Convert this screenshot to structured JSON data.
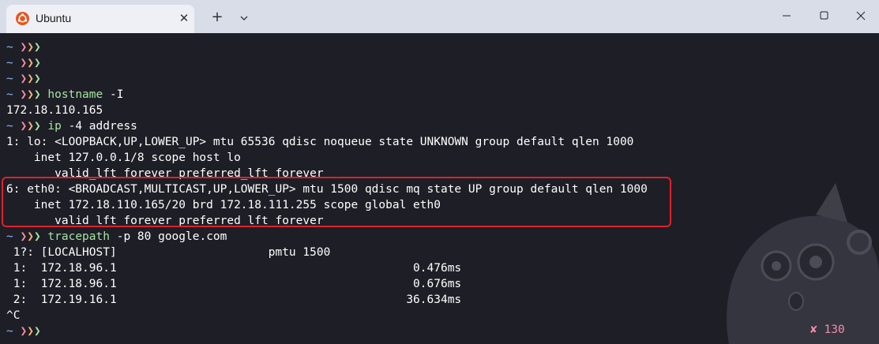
{
  "window": {
    "tab_title": "Ubuntu",
    "tab_close_glyph": "✕",
    "new_tab_glyph": "+",
    "icons": {
      "app": "ubuntu-logo-icon",
      "dropdown": "chevron-down-icon",
      "minimize": "minimize-icon",
      "maximize": "maximize-icon",
      "close": "close-icon"
    },
    "colors": {
      "titlebar": "#d9dde8",
      "tab": "#eef0f5",
      "terminal_bg": "#1e1e26",
      "highlight_border": "#e0202a"
    }
  },
  "prompt": {
    "tilde": "~",
    "arrow": "❯",
    "colors": {
      "tilde": "#89b4fa",
      "arrow1": "#f38ba8",
      "arrow2": "#f9b27a",
      "arrow3": "#a6e3a1",
      "command": "#a6e3a1"
    }
  },
  "terminal": {
    "lines": [
      {
        "type": "prompt",
        "cmd": "",
        "args": ""
      },
      {
        "type": "prompt",
        "cmd": "",
        "args": ""
      },
      {
        "type": "prompt",
        "cmd": "",
        "args": ""
      },
      {
        "type": "prompt",
        "cmd": "hostname",
        "args": " -I"
      },
      {
        "type": "output",
        "text": "172.18.110.165"
      },
      {
        "type": "prompt",
        "cmd": "ip",
        "args": " -4 address"
      },
      {
        "type": "output",
        "text": "1: lo: <LOOPBACK,UP,LOWER_UP> mtu 65536 qdisc noqueue state UNKNOWN group default qlen 1000"
      },
      {
        "type": "output",
        "text": "    inet 127.0.0.1/8 scope host lo"
      },
      {
        "type": "output",
        "text": "       valid_lft forever preferred_lft forever"
      },
      {
        "type": "output",
        "text": "6: eth0: <BROADCAST,MULTICAST,UP,LOWER_UP> mtu 1500 qdisc mq state UP group default qlen 1000"
      },
      {
        "type": "output",
        "text": "    inet 172.18.110.165/20 brd 172.18.111.255 scope global eth0"
      },
      {
        "type": "output",
        "text": "       valid_lft forever preferred_lft forever"
      },
      {
        "type": "prompt",
        "cmd": "tracepath",
        "args": " -p 80 google.com"
      },
      {
        "type": "output",
        "text": " 1?: [LOCALHOST]                      pmtu 1500"
      },
      {
        "type": "output",
        "text": " 1:  172.18.96.1                                           0.476ms"
      },
      {
        "type": "output",
        "text": " 1:  172.18.96.1                                           0.676ms"
      },
      {
        "type": "output",
        "text": " 2:  172.19.16.1                                          36.634ms"
      },
      {
        "type": "output",
        "text": "^C"
      },
      {
        "type": "prompt_short",
        "cmd": "",
        "args": ""
      }
    ],
    "exit_status": "✘ 130"
  }
}
